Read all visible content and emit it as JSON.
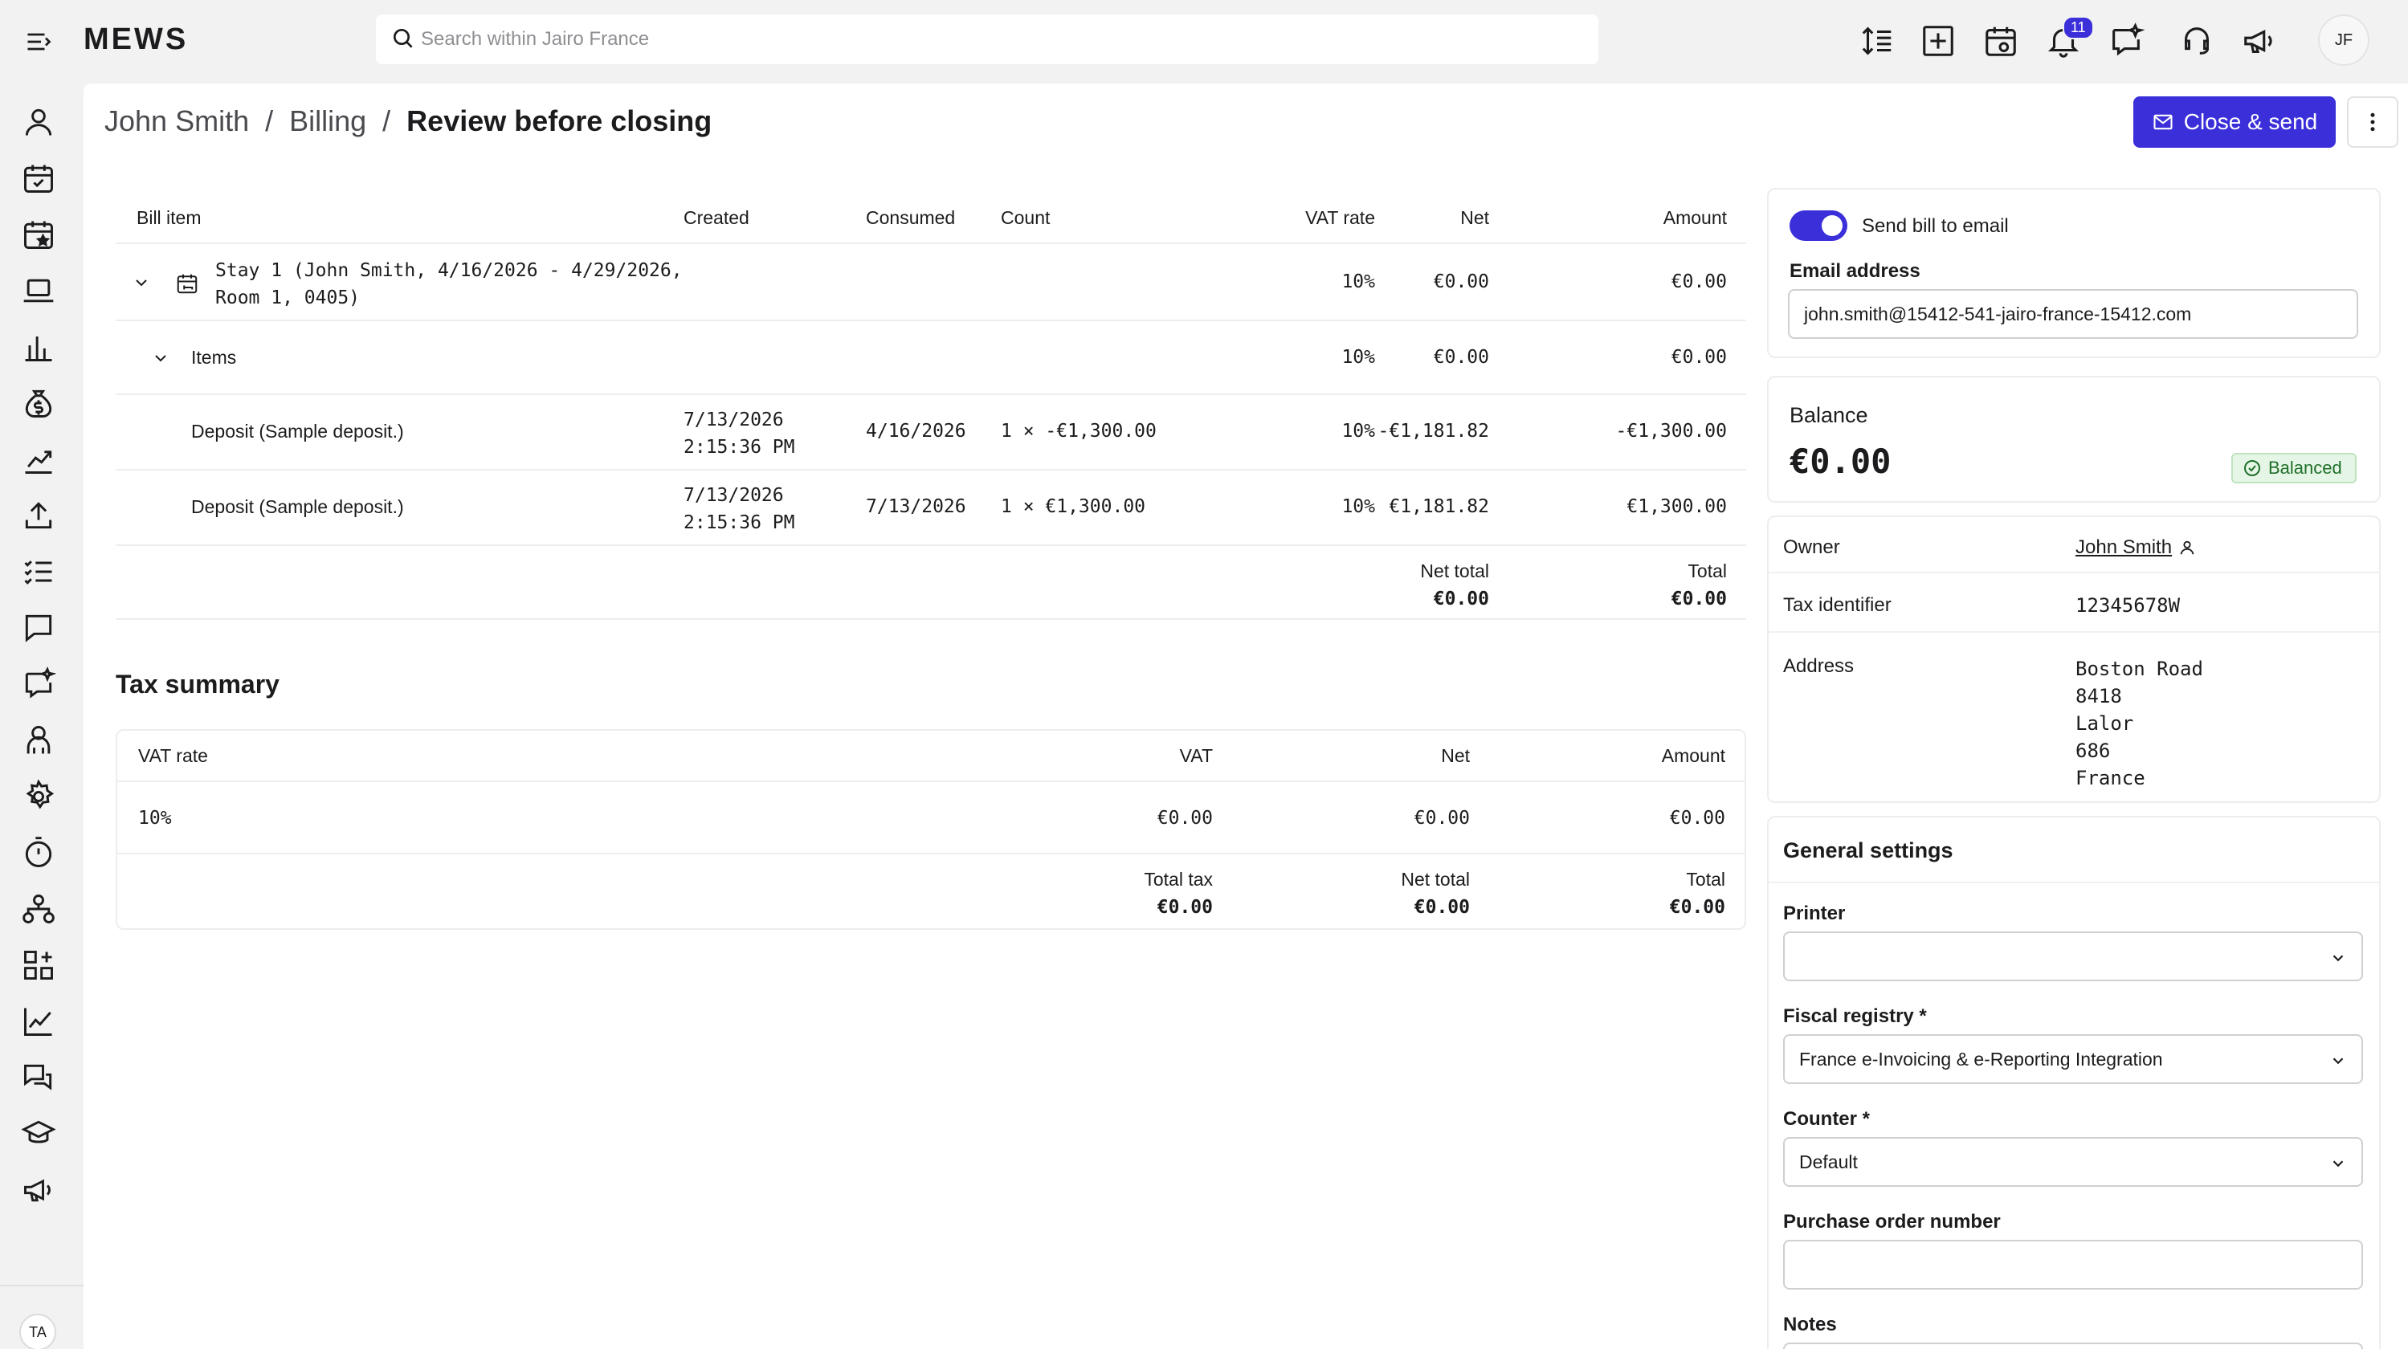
{
  "app": {
    "logo": "MEWS",
    "search_placeholder": "Search within Jairo France",
    "notification_count": "11",
    "user_initials": "JF",
    "nav_user_initials": "TA"
  },
  "breadcrumb": {
    "items": [
      "John Smith",
      "Billing"
    ],
    "current": "Review before closing",
    "separator": "/"
  },
  "actions": {
    "close_send": "Close & send"
  },
  "bill": {
    "headers": [
      "Bill item",
      "Created",
      "Consumed",
      "Count",
      "VAT rate",
      "Net",
      "Amount"
    ],
    "stay": {
      "label_line1": "Stay 1 (John Smith, 4/16/2026 - 4/29/2026,",
      "label_line2": "Room 1, 0405)",
      "vat": "10%",
      "net": "€0.00",
      "amount": "€0.00"
    },
    "items_group": {
      "label": "Items",
      "vat": "10%",
      "net": "€0.00",
      "amount": "€0.00"
    },
    "rows": [
      {
        "item": "Deposit (Sample deposit.)",
        "created_date": "7/13/2026",
        "created_time": "2:15:36 PM",
        "consumed": "4/16/2026",
        "count": "1 × -€1,300.00",
        "vat": "10%",
        "net": "-€1,181.82",
        "amount": "-€1,300.00"
      },
      {
        "item": "Deposit (Sample deposit.)",
        "created_date": "7/13/2026",
        "created_time": "2:15:36 PM",
        "consumed": "7/13/2026",
        "count": "1 × €1,300.00",
        "vat": "10%",
        "net": "€1,181.82",
        "amount": "€1,300.00"
      }
    ],
    "totals": {
      "net_label": "Net total",
      "net_value": "€0.00",
      "total_label": "Total",
      "total_value": "€0.00"
    }
  },
  "tax_summary": {
    "title": "Tax summary",
    "headers": [
      "VAT rate",
      "VAT",
      "Net",
      "Amount"
    ],
    "row": {
      "rate": "10%",
      "vat": "€0.00",
      "net": "€0.00",
      "amount": "€0.00"
    },
    "totals": {
      "tax_label": "Total tax",
      "tax_value": "€0.00",
      "net_label": "Net total",
      "net_value": "€0.00",
      "total_label": "Total",
      "total_value": "€0.00"
    }
  },
  "email_card": {
    "toggle_label": "Send bill to email",
    "toggle_on": true,
    "email_label": "Email address",
    "email_value": "john.smith@15412-541-jairo-france-15412.com"
  },
  "balance_card": {
    "label": "Balance",
    "value": "€0.00",
    "status": "Balanced"
  },
  "owner_card": {
    "owner_label": "Owner",
    "owner_value": "John Smith",
    "tax_id_label": "Tax identifier",
    "tax_id_value": "12345678W",
    "address_label": "Address",
    "address_lines": [
      "Boston Road",
      "8418",
      "Lalor",
      "686",
      "France"
    ]
  },
  "settings_card": {
    "title": "General settings",
    "printer_label": "Printer",
    "printer_value": "",
    "fiscal_label": "Fiscal registry *",
    "fiscal_value": "France e-Invoicing & e-Reporting Integration",
    "counter_label": "Counter *",
    "counter_value": "Default",
    "po_label": "Purchase order number",
    "po_value": "",
    "notes_label": "Notes"
  },
  "colors": {
    "accent": "#3b2fd9",
    "balanced_bg": "#e6f6e6",
    "balanced_text": "#1f6f2b"
  }
}
